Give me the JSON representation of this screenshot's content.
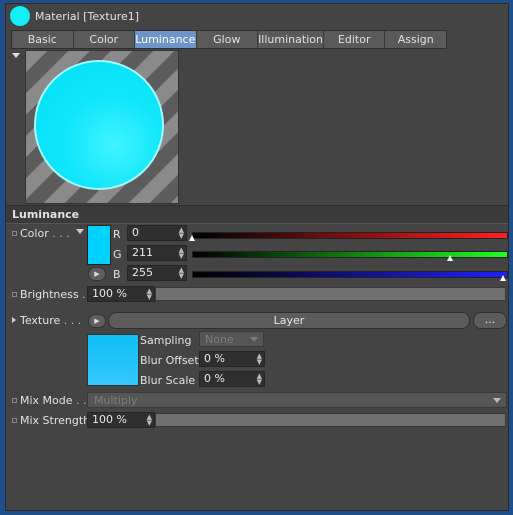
{
  "header": {
    "title": "Material [Texture1]"
  },
  "tabs": [
    {
      "label": "Basic"
    },
    {
      "label": "Color"
    },
    {
      "label": "Luminance"
    },
    {
      "label": "Glow"
    },
    {
      "label": "Illumination"
    },
    {
      "label": "Editor"
    },
    {
      "label": "Assign"
    }
  ],
  "active_tab": "Luminance",
  "section_title": "Luminance",
  "color": {
    "label": "Color",
    "dots": ". . .",
    "swatch": "#00d3ff",
    "r": {
      "label": "R",
      "value": "0"
    },
    "g": {
      "label": "G",
      "value": "211"
    },
    "b": {
      "label": "B",
      "value": "255"
    }
  },
  "brightness": {
    "label": "Brightness",
    "dots": ".",
    "value": "100 %"
  },
  "texture": {
    "label": "Texture",
    "dots": ". . .",
    "button_label": "Layer",
    "more_label": "...",
    "sampling_label": "Sampling",
    "sampling_value": "None",
    "blur_offset_label": "Blur Offset",
    "blur_offset_value": "0 %",
    "blur_scale_label": "Blur Scale",
    "blur_scale_value": "0 %"
  },
  "mix_mode": {
    "label": "Mix Mode",
    "dots": ". .",
    "value": "Multiply"
  },
  "mix_strength": {
    "label": "Mix Strength",
    "value": "100 %"
  },
  "colors": {
    "accent": "#6e95c8",
    "cyan": "#00d3ff",
    "background": "#444444"
  }
}
